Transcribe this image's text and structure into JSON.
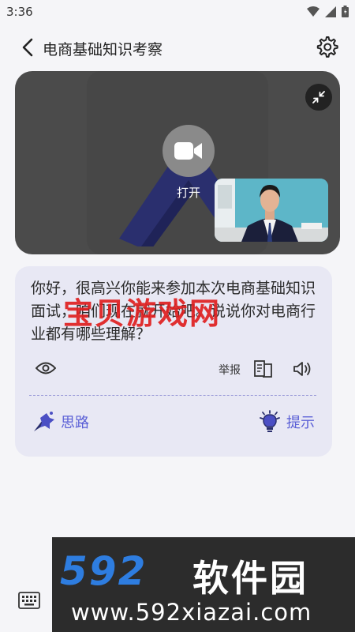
{
  "status": {
    "time": "3:36"
  },
  "header": {
    "title": "电商基础知识考察"
  },
  "video": {
    "camera_label": "打开"
  },
  "chat": {
    "question": "你好，很高兴你能来参加本次电商基础知识面试，咱们现在就开始吧。说说你对电商行业都有哪些理解？",
    "report_label": "举报",
    "thoughts_label": "思路",
    "hint_label": "提示"
  },
  "watermarks": {
    "overlay": "宝贝游戏网",
    "banner_logo": "592",
    "banner_text": "软件园",
    "banner_url": "www.592xiazai.com"
  },
  "colors": {
    "accent": "#5a5fd6",
    "card_bg": "#e8e8f4",
    "video_bg": "#4b4b4b",
    "watermark_red": "#e02020",
    "banner_blue": "#2e7de0"
  },
  "icons": [
    "back-arrow-icon",
    "settings-gear-icon",
    "video-camera-icon",
    "collapse-icon",
    "eye-icon",
    "translate-icon",
    "speaker-icon",
    "thoughts-icon",
    "lightbulb-icon",
    "keyboard-icon",
    "wifi-icon",
    "signal-icon",
    "battery-icon"
  ]
}
